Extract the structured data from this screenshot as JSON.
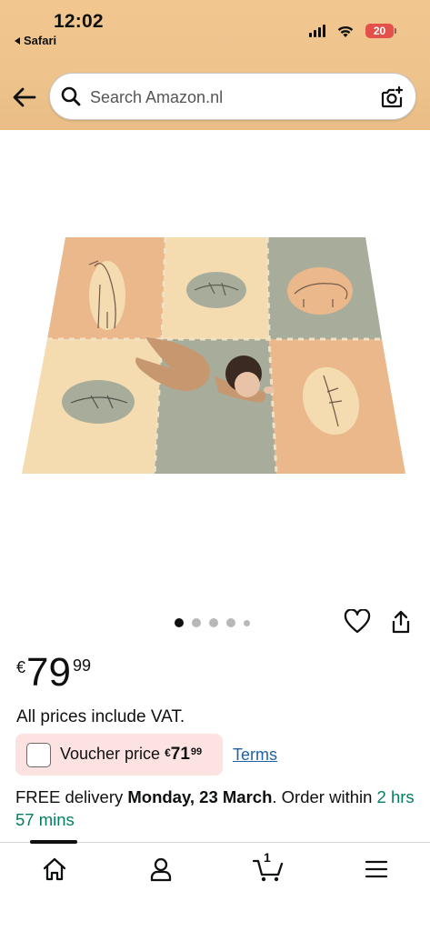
{
  "status_bar": {
    "time": "12:02",
    "back_app": "Safari",
    "battery": "20"
  },
  "header": {
    "search_placeholder": "Search Amazon.nl",
    "colors": {
      "header_bg": "#eec38c"
    }
  },
  "product": {
    "image_name": "baby play mat with animal and leaf tiles",
    "carousel": {
      "count": 5,
      "active": 1
    },
    "price": {
      "currency": "€",
      "whole": "79",
      "fraction": "99"
    },
    "vat_note": "All prices include VAT.",
    "voucher": {
      "label": "Voucher price",
      "currency": "€",
      "whole": "71",
      "fraction": "99",
      "terms": "Terms"
    },
    "delivery": {
      "prefix": "FREE delivery ",
      "date": "Monday, 23 March",
      "middle": ". Order within ",
      "countdown": "2 hrs 57 mins"
    }
  },
  "bottom_nav": {
    "items": [
      "home-icon",
      "account-icon",
      "cart-icon",
      "menu-icon"
    ],
    "cart_count": "1"
  }
}
